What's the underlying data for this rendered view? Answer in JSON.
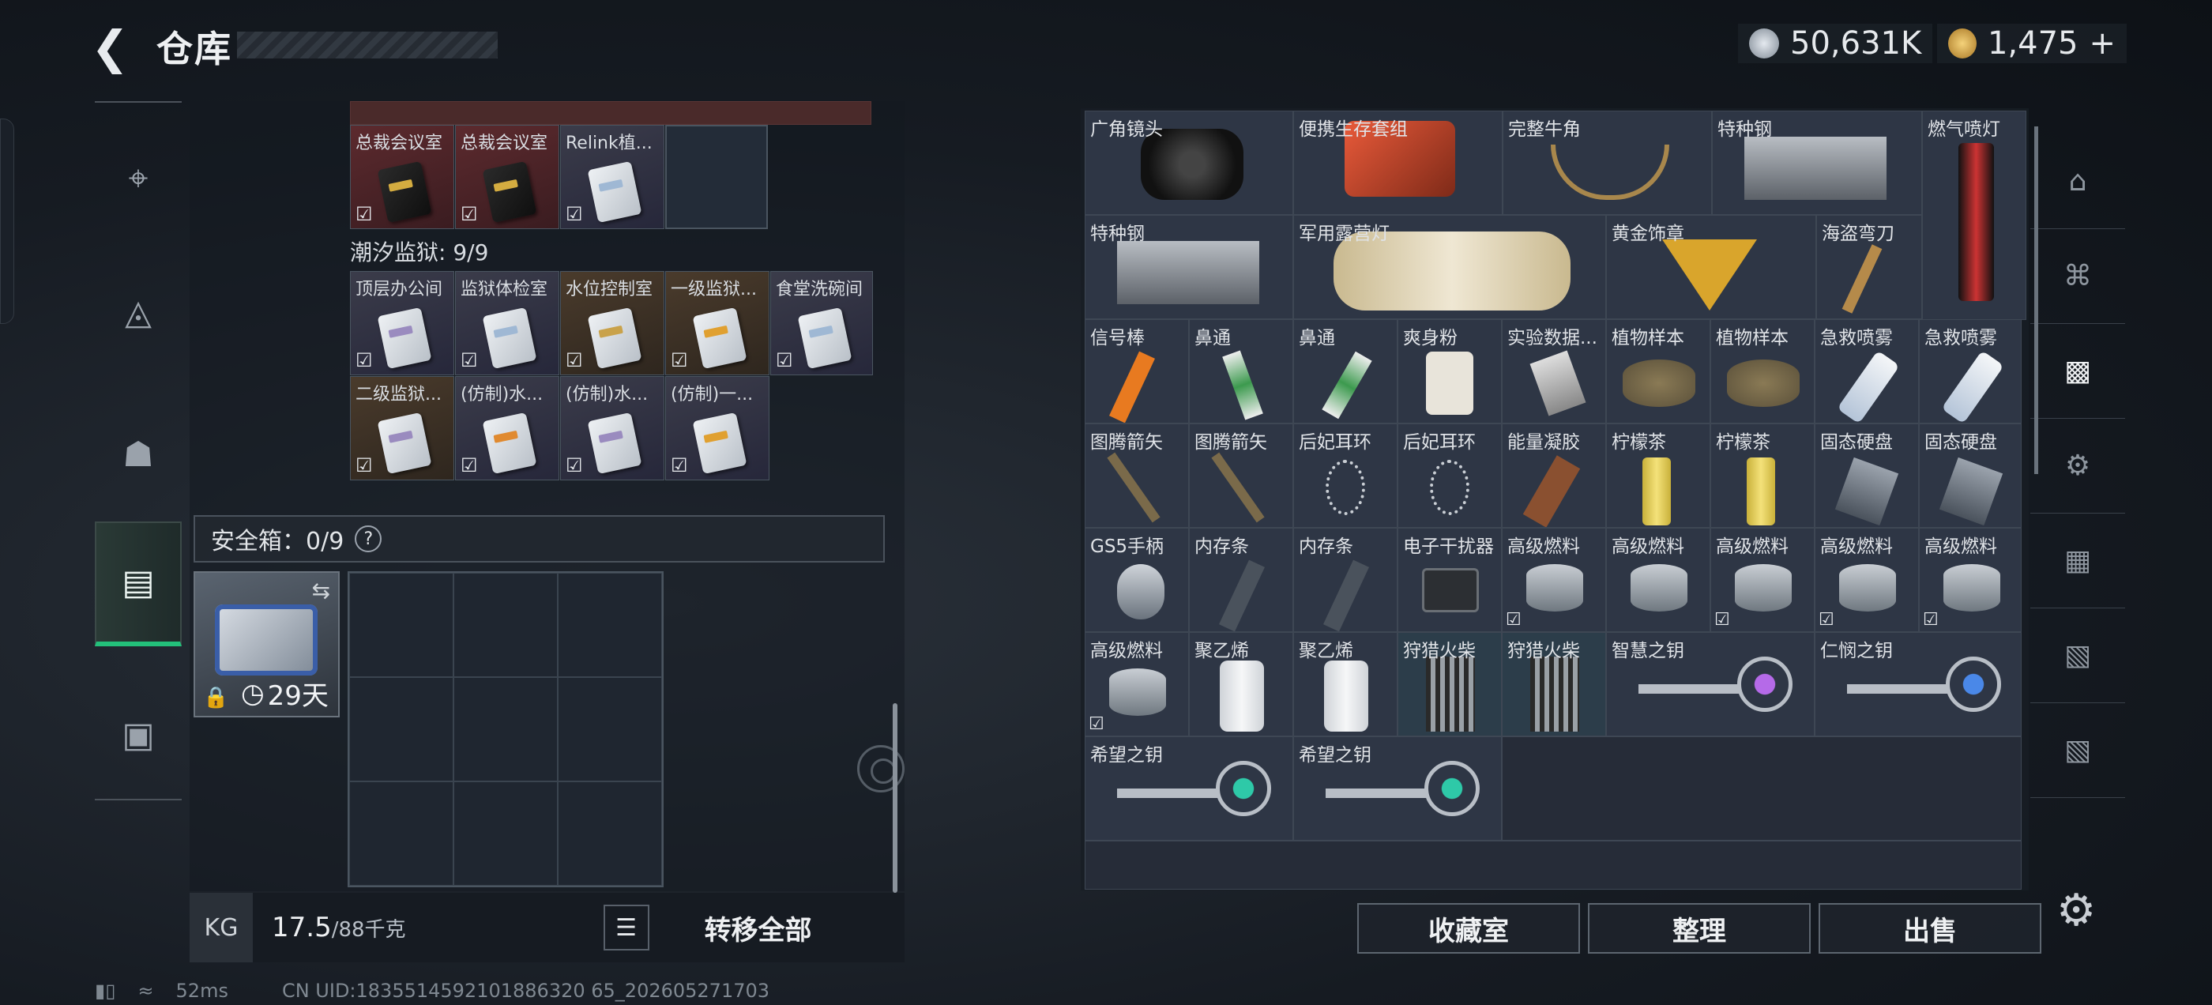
{
  "header": {
    "title": "仓库",
    "back_icon": "back-arrow-icon"
  },
  "currency": {
    "silver": "50,631K",
    "gold": "1,475",
    "gold_add": "+",
    "silver_color": "#b9c3cf",
    "gold_color": "#d9a94a"
  },
  "leftnav": {
    "items": [
      {
        "icon": "pistol-icon"
      },
      {
        "icon": "vest-icon"
      },
      {
        "icon": "backpack-icon"
      },
      {
        "icon": "locker-icon",
        "active": true
      },
      {
        "icon": "toolbox-icon"
      }
    ]
  },
  "cards_top": {
    "labels": [
      "总裁会议室",
      "总裁会议室",
      "Relink植..."
    ]
  },
  "prison": {
    "label": "潮汐监狱: 9/9",
    "row1": [
      "顶层办公间",
      "监狱体检室",
      "水位控制室",
      "一级监狱...",
      "食堂洗碗间"
    ],
    "row2": [
      "二级监狱...",
      "(仿制)水...",
      "(仿制)水...",
      "(仿制)一..."
    ]
  },
  "safebox": {
    "label": "安全箱：0/9",
    "help": "?",
    "days": "29天"
  },
  "weight": {
    "current": "17.5",
    "max": "/88千克",
    "kg_label": "KG"
  },
  "actions": {
    "transfer_all": "转移全部",
    "collection": "收藏室",
    "organize": "整理",
    "sell": "出售"
  },
  "status": {
    "ping": "52ms",
    "uid": "CN UID:1835514592101886320 65_202605271703"
  },
  "right_items": {
    "r1": [
      "广角镜头",
      "便携生存套组",
      "完整牛角",
      "特种钢",
      "燃气喷灯"
    ],
    "r2": [
      "特种钢",
      "军用露营灯",
      "黄金饰章",
      "海盗弯刀"
    ],
    "r3": [
      "信号棒",
      "鼻通",
      "鼻通",
      "爽身粉",
      "实验数据...",
      "植物样本",
      "植物样本",
      "急救喷雾",
      "急救喷雾"
    ],
    "r4": [
      "图腾箭矢",
      "图腾箭矢",
      "后妃耳环",
      "后妃耳环",
      "能量凝胶",
      "柠檬茶",
      "柠檬茶",
      "固态硬盘",
      "固态硬盘"
    ],
    "r5": [
      "GS5手柄",
      "内存条",
      "内存条",
      "电子干扰器",
      "高级燃料",
      "高级燃料",
      "高级燃料",
      "高级燃料",
      "高级燃料"
    ],
    "r6": [
      "高级燃料",
      "聚乙烯",
      "聚乙烯",
      "狩猎火柴",
      "狩猎火柴",
      "智慧之钥",
      "仁悯之钥"
    ],
    "r7": [
      "希望之钥",
      "希望之钥"
    ]
  }
}
